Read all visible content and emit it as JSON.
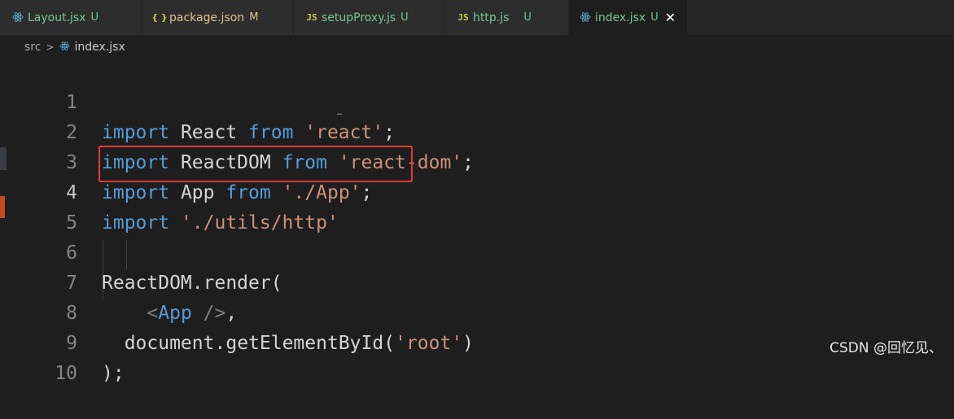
{
  "tabs": [
    {
      "name": "Layout.jsx",
      "status": "U",
      "icon": "react-icon"
    },
    {
      "name": "package.json",
      "status": "M",
      "icon": "json-icon"
    },
    {
      "name": "setupProxy.js",
      "status": "U",
      "icon": "js-icon"
    },
    {
      "name": "http.js",
      "status": "U",
      "icon": "js-icon"
    },
    {
      "name": "index.jsx",
      "status": "U",
      "icon": "react-icon",
      "active": true
    }
  ],
  "icon_glyphs": {
    "json": "{ }",
    "js": "JS"
  },
  "breadcrumb": {
    "folder": "src",
    "file": "index.jsx"
  },
  "lines": [
    {
      "num": "1",
      "tokens": [
        "import",
        " React ",
        "from",
        " 'react'",
        ";"
      ]
    },
    {
      "num": "2",
      "tokens": [
        "import",
        " ReactDOM ",
        "from",
        " 'react-dom'",
        ";"
      ]
    },
    {
      "num": "3",
      "tokens": [
        "import",
        " App ",
        "from",
        " './App'",
        ";"
      ]
    },
    {
      "num": "4",
      "tokens": [
        "import",
        " './utils/http'"
      ]
    },
    {
      "num": "5",
      "tokens": []
    },
    {
      "num": "6",
      "tokens": [
        "ReactDOM",
        ".",
        "render",
        "("
      ]
    },
    {
      "num": "7",
      "tokens": [
        "    ",
        "<",
        "App",
        " />",
        ","
      ]
    },
    {
      "num": "8",
      "tokens": [
        "  document",
        ".",
        "getElementById",
        "(",
        "'root'",
        ")"
      ]
    },
    {
      "num": "9",
      "tokens": [
        ");"
      ]
    },
    {
      "num": "10",
      "tokens": []
    }
  ],
  "ellipsis": "…",
  "watermark": "CSDN @回忆见、",
  "colors": {
    "keyword": "#569cd6",
    "string": "#ce9178",
    "highlight_box": "#e03a3a",
    "untracked": "#73c991",
    "modified": "#e2c08d"
  }
}
